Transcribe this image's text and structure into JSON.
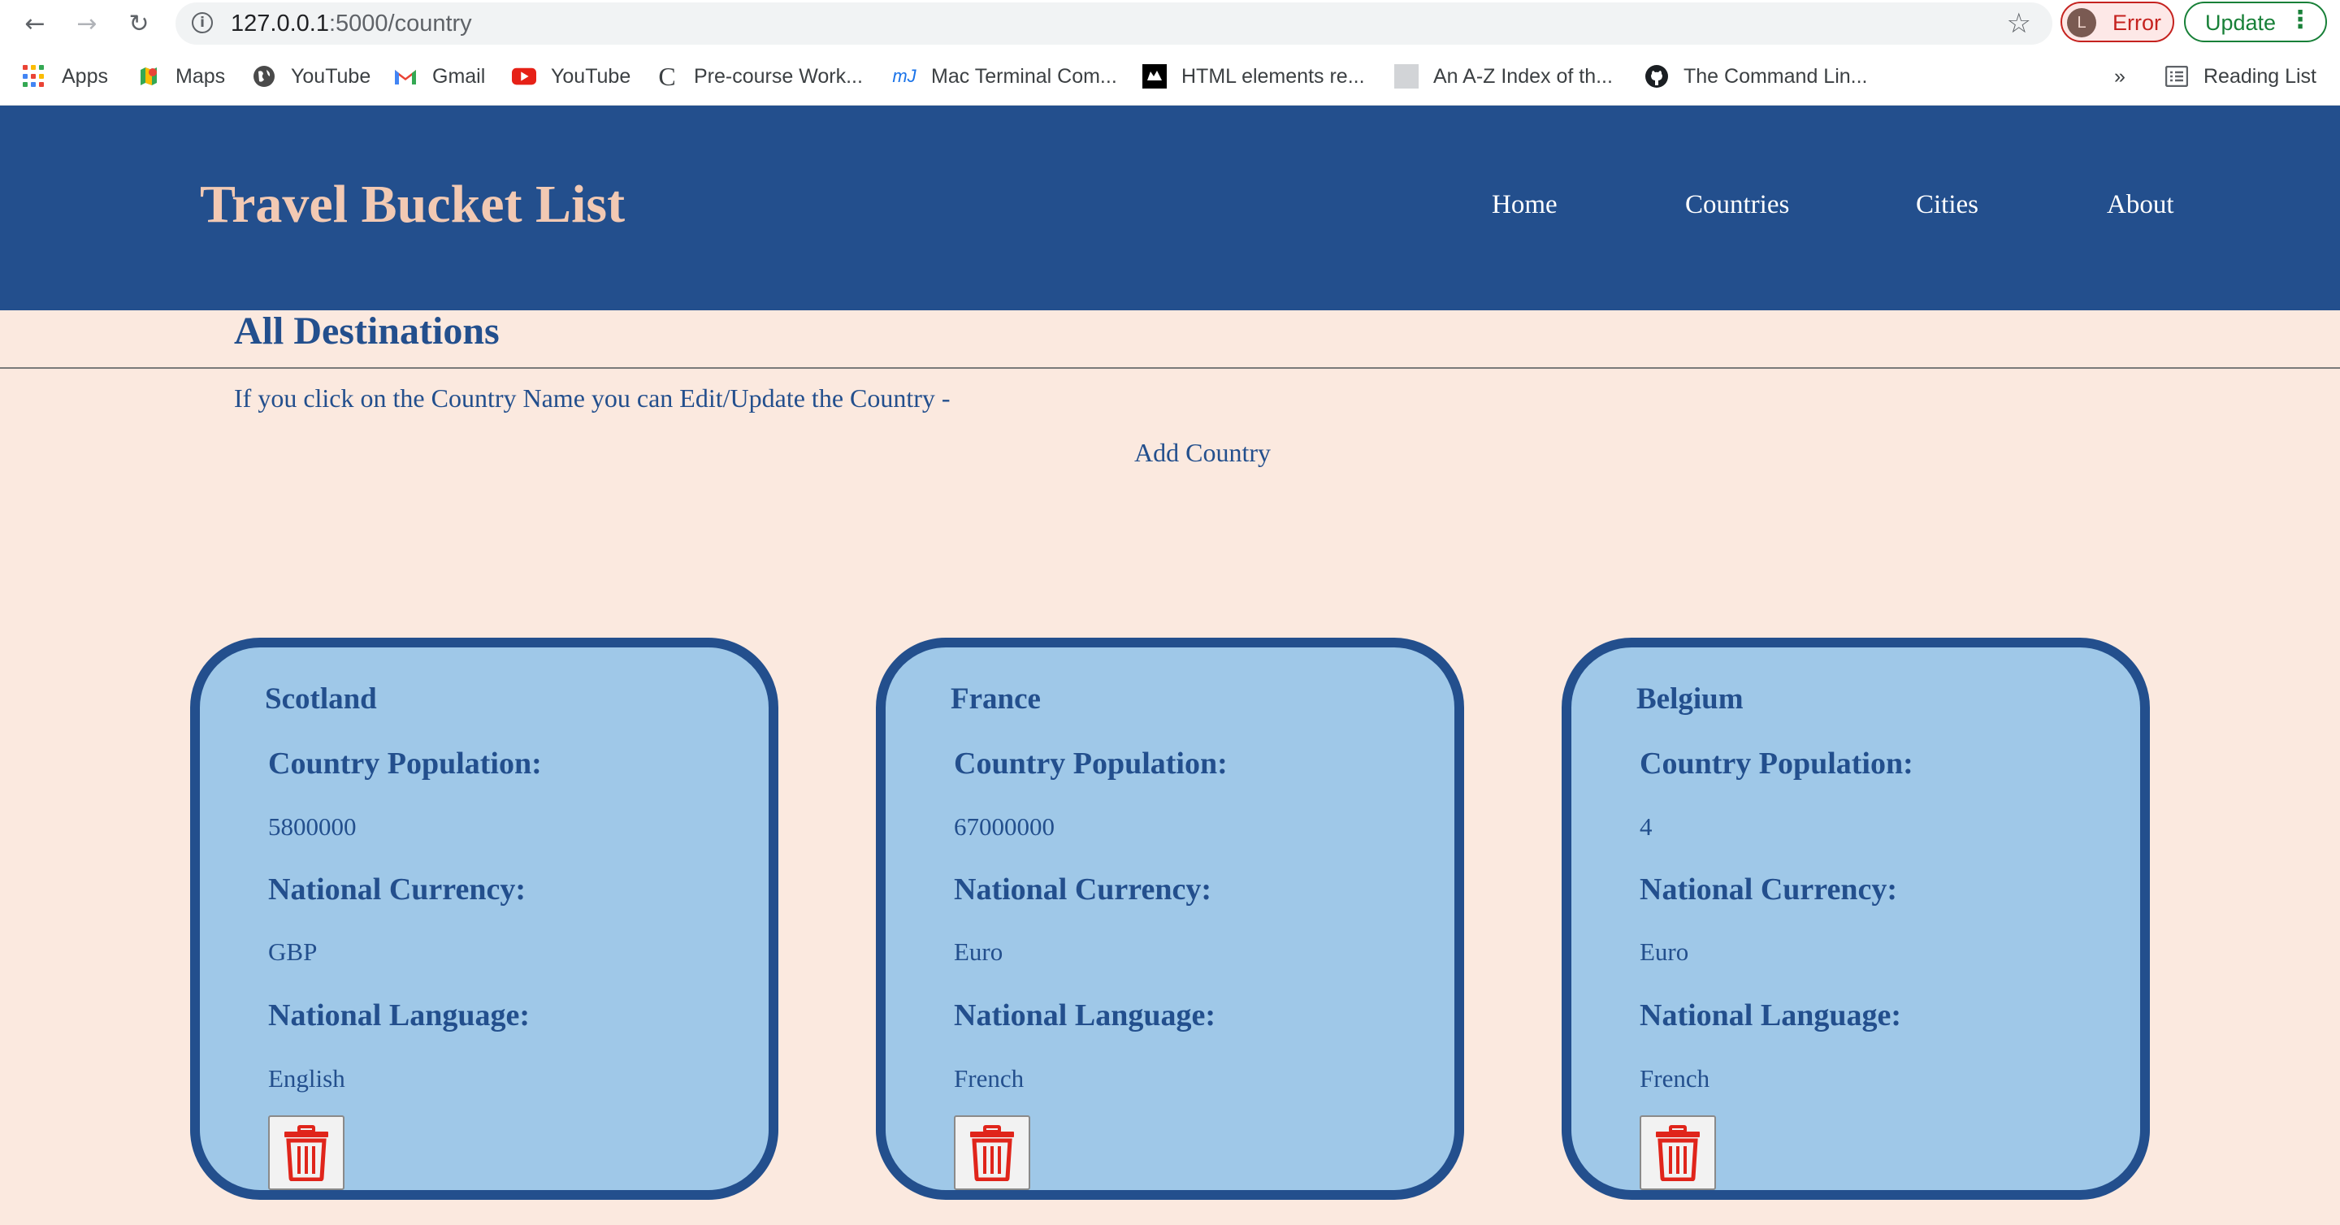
{
  "browser": {
    "url_host": "127.0.0.1",
    "url_rest": ":5000/country",
    "profile_initial": "L",
    "error_label": "Error",
    "update_label": "Update",
    "bookmarks": [
      {
        "label": "Apps",
        "icon": "apps-grid-icon"
      },
      {
        "label": "Maps",
        "icon": "maps-icon"
      },
      {
        "label": "YouTube",
        "icon": "globe-icon"
      },
      {
        "label": "Gmail",
        "icon": "gmail-icon"
      },
      {
        "label": "YouTube",
        "icon": "youtube-icon"
      },
      {
        "label": "Pre-course Work...",
        "icon": "c-logo-icon"
      },
      {
        "label": "Mac Terminal Com...",
        "icon": "mj-logo-icon"
      },
      {
        "label": "HTML elements re...",
        "icon": "mdn-icon"
      },
      {
        "label": "An A-Z Index of th...",
        "icon": "blank-page-icon"
      },
      {
        "label": "The Command Lin...",
        "icon": "github-icon"
      }
    ],
    "overflow_label": "»",
    "reading_list_label": "Reading List"
  },
  "site": {
    "title": "Travel Bucket List",
    "nav": [
      "Home",
      "Countries",
      "Cities",
      "About"
    ],
    "colors": {
      "header_bg": "#234f8d",
      "title": "#f2c9b3",
      "page_bg": "#fbe9df",
      "card_bg": "#9fc8e8",
      "delete_icon": "#e0251b"
    }
  },
  "page": {
    "heading": "All Destinations",
    "hint": "If you click on the Country Name you can Edit/Update the Country -",
    "add_link": "Add Country"
  },
  "labels": {
    "population": "Country Population:",
    "currency": "National Currency:",
    "language": "National Language:"
  },
  "countries": [
    {
      "name": "Scotland",
      "population": "5800000",
      "currency": "GBP",
      "language": "English"
    },
    {
      "name": "France",
      "population": "67000000",
      "currency": "Euro",
      "language": "French"
    },
    {
      "name": "Belgium",
      "population": "4",
      "currency": "Euro",
      "language": "French"
    }
  ]
}
